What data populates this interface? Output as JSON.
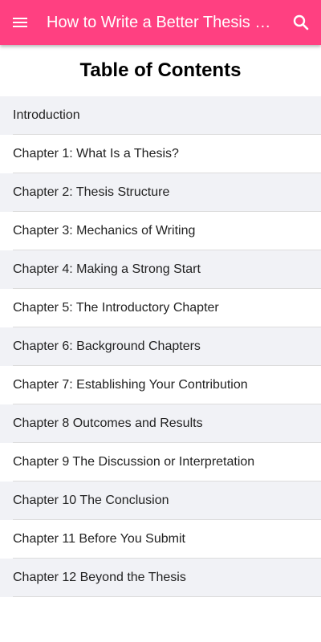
{
  "appbar": {
    "title": "How to Write a Better Thesis …",
    "menu_icon": "menu-icon",
    "search_icon": "search-icon",
    "color": "#ff4081"
  },
  "toc": {
    "heading": "Table of Contents",
    "items": [
      {
        "label": "Introduction"
      },
      {
        "label": "Chapter 1: What Is a Thesis?"
      },
      {
        "label": "Chapter 2: Thesis Structure"
      },
      {
        "label": "Chapter 3: Mechanics of Writing"
      },
      {
        "label": "Chapter 4: Making a Strong Start"
      },
      {
        "label": "Chapter 5: The Introductory Chapter"
      },
      {
        "label": "Chapter 6: Background Chapters"
      },
      {
        "label": "Chapter 7: Establishing Your Contribution"
      },
      {
        "label": "Chapter 8 Outcomes and Results"
      },
      {
        "label": "Chapter 9 The Discussion or Interpretation"
      },
      {
        "label": "Chapter 10 The Conclusion"
      },
      {
        "label": "Chapter 11 Before You Submit"
      },
      {
        "label": "Chapter 12 Beyond the Thesis"
      }
    ]
  }
}
